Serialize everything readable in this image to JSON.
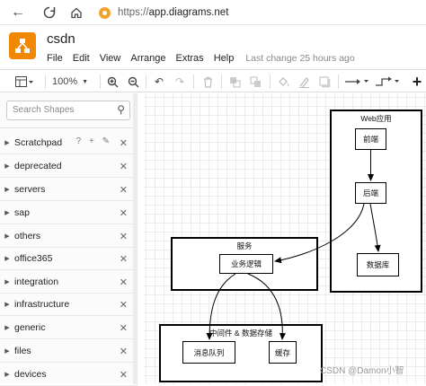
{
  "browser": {
    "url_protocol": "https://",
    "url_host": "app.diagrams.net",
    "back_icon": "back-arrow-icon",
    "forward_icon": "forward-arrow-icon",
    "reload_icon": "reload-icon",
    "home_icon": "home-icon",
    "security_icon": "warning-icon"
  },
  "app": {
    "title": "csdn",
    "menu": [
      "File",
      "Edit",
      "View",
      "Arrange",
      "Extras",
      "Help"
    ],
    "last_change": "Last change 25 hours ago",
    "brand_color": "#f08705"
  },
  "toolbar": {
    "zoom": "100%",
    "add_label": "+"
  },
  "sidebar": {
    "search_placeholder": "Search Shapes",
    "libraries": [
      {
        "label": "Scratchpad",
        "extra": "? + ✎"
      },
      {
        "label": "deprecated"
      },
      {
        "label": "servers"
      },
      {
        "label": "sap"
      },
      {
        "label": "others"
      },
      {
        "label": "office365"
      },
      {
        "label": "integration"
      },
      {
        "label": "infrastructure"
      },
      {
        "label": "generic"
      },
      {
        "label": "files"
      },
      {
        "label": "devices"
      }
    ],
    "close_glyph": "✕"
  },
  "diagram": {
    "web_app": {
      "title": "Web应用",
      "frontend": "前端",
      "backend": "后端",
      "database": "数据库"
    },
    "service": {
      "title": "服务",
      "business_logic": "业务逻辑"
    },
    "middleware": {
      "title": "中间件 & 数据存储",
      "message_queue": "消息队列",
      "cache": "缓存"
    }
  },
  "watermark": "CSDN @Damon小智"
}
